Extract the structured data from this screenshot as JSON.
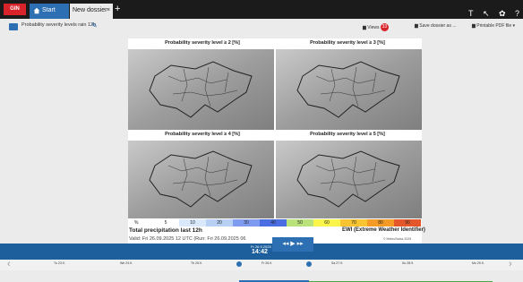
{
  "topbar": {
    "logo": "GIN",
    "tabs": [
      {
        "label": "Start page"
      },
      {
        "label": "New dossier"
      }
    ],
    "close_glyph": "×",
    "add_tab": "+"
  },
  "toolbar": {
    "document_title": "Probability severity levels rain 12h",
    "views_label": "Views",
    "views_badge": "33",
    "save_label": "Save dossier as ...",
    "pdf_label": "Printable PDF file"
  },
  "figure": {
    "panels": [
      {
        "title": "Probability severity level ≥ 2 [%]"
      },
      {
        "title": "Probability severity level ≥ 3 [%]"
      },
      {
        "title": "Probability severity level ≥ 4 [%]"
      },
      {
        "title": "Probability severity level ≥ 5 [%]"
      }
    ],
    "legend": {
      "unit": "%",
      "items": [
        {
          "label": "5",
          "color": "#ffffff"
        },
        {
          "label": "10",
          "color": "#d9e8fa"
        },
        {
          "label": "20",
          "color": "#b6cff3"
        },
        {
          "label": "30",
          "color": "#7e9bf0"
        },
        {
          "label": "40",
          "color": "#4b6de2"
        },
        {
          "label": "50",
          "color": "#b9e27a"
        },
        {
          "label": "60",
          "color": "#fbf54a"
        },
        {
          "label": "70",
          "color": "#f8c431"
        },
        {
          "label": "80",
          "color": "#f49a26"
        },
        {
          "label": "90",
          "color": "#e4572a"
        }
      ]
    },
    "main_title": "Total precipitation last 12h",
    "right_title": "EWI (Extreme Weather Identifier)",
    "valid_text": "Valid: Fri 26.09.2025 12 UTC   (Run: Fri 26.09.2025 06",
    "copyright": "© MeteoSwiss 2025"
  },
  "timeline": {
    "date_label": "Fr 26.9.2025",
    "time_label": "14:42",
    "day_labels": [
      "Tu 23.9.",
      "We 24.9.",
      "Th 25.9.",
      "Fr 26.9.",
      "Sa 27.9.",
      "Su 28.9.",
      "Mo 29.9."
    ]
  }
}
